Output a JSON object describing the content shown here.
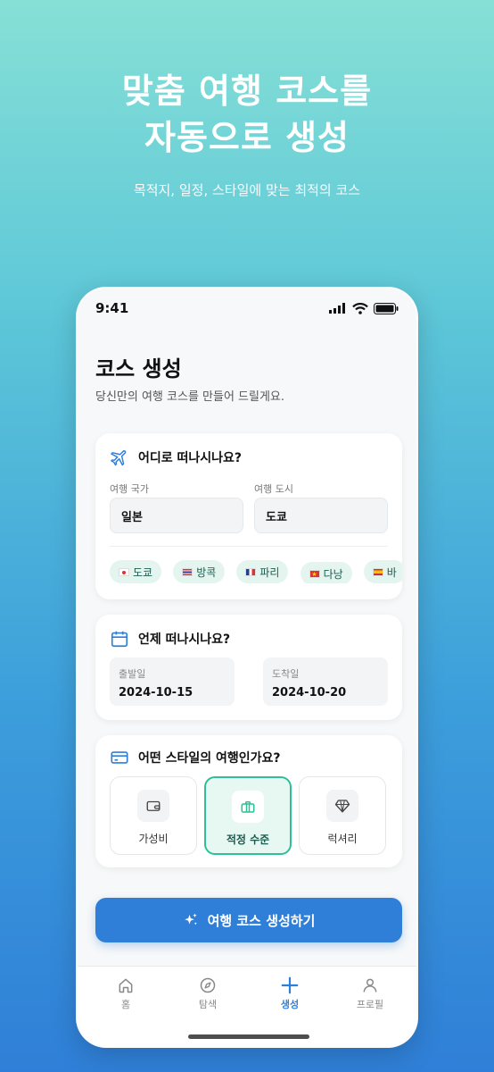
{
  "hero": {
    "title_line1": "맞춤 여행 코스를",
    "title_line2": "자동으로 생성",
    "subtitle": "목적지, 일정, 스타일에 맞는 최적의 코스"
  },
  "status_bar": {
    "time": "9:41"
  },
  "page": {
    "title": "코스 생성",
    "description": "당신만의 여행 코스를 만들어 드릴게요."
  },
  "destination_card": {
    "heading": "어디로 떠나시나요?",
    "country_label": "여행 국가",
    "country_value": "일본",
    "city_label": "여행 도시",
    "city_value": "도쿄",
    "quick_chips": [
      {
        "label": "도쿄"
      },
      {
        "label": "방콕"
      },
      {
        "label": "파리"
      },
      {
        "label": "다낭"
      },
      {
        "label": "바"
      }
    ]
  },
  "date_card": {
    "heading": "언제 떠나시나요?",
    "departure_label": "출발일",
    "departure_value": "2024-10-15",
    "arrival_label": "도착일",
    "arrival_value": "2024-10-20"
  },
  "style_card": {
    "heading": "어떤 스타일의 여행인가요?",
    "options": [
      {
        "label": "가성비",
        "icon": "wallet-icon",
        "selected": false
      },
      {
        "label": "적정 수준",
        "icon": "briefcase-icon",
        "selected": true
      },
      {
        "label": "럭셔리",
        "icon": "diamond-icon",
        "selected": false
      }
    ]
  },
  "cta": {
    "label": "여행 코스 생성하기",
    "icon": "sparkle-icon"
  },
  "tab_bar": {
    "items": [
      {
        "label": "홈",
        "icon": "home-icon",
        "active": false
      },
      {
        "label": "탐색",
        "icon": "compass-icon",
        "active": false
      },
      {
        "label": "생성",
        "icon": "plus-icon",
        "active": true
      },
      {
        "label": "프로필",
        "icon": "profile-icon",
        "active": false
      }
    ]
  },
  "colors": {
    "accent_blue": "#2f7fd8",
    "accent_green": "#2dbf97",
    "chip_bg": "#e4f5ef"
  }
}
